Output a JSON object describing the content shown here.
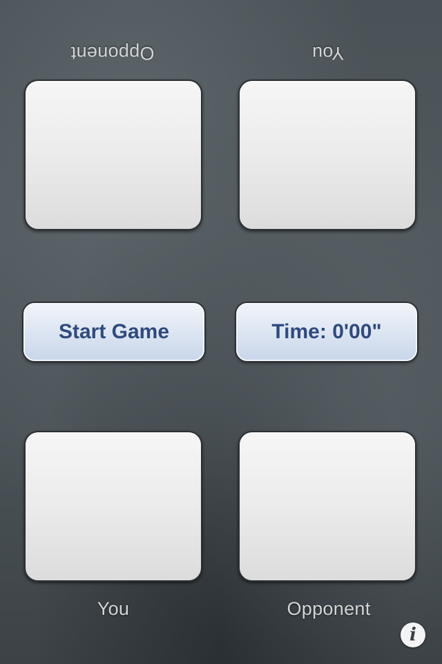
{
  "top_area": {
    "left_label": "Opponent",
    "right_label": "You"
  },
  "controls": {
    "start_button_label": "Start Game",
    "timer_label": "Time: 0'00\""
  },
  "bottom_area": {
    "left_label": "You",
    "right_label": "Opponent"
  },
  "info_button": {
    "glyph": "i",
    "icon": "info-icon"
  }
}
